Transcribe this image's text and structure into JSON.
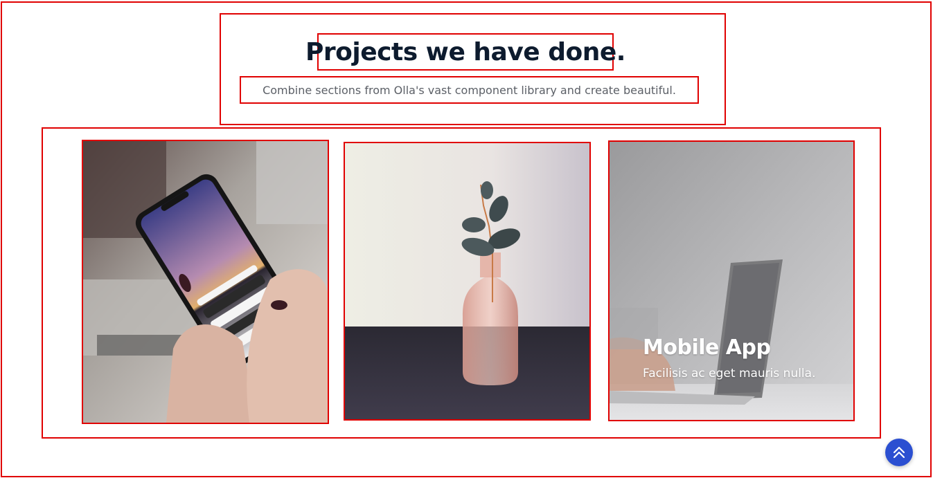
{
  "section": {
    "title": "Projects we have done.",
    "subtitle": "Combine sections from Olla's vast component library and create beautiful."
  },
  "projects": [
    {
      "image": "phone-in-hands-photo"
    },
    {
      "image": "glass-vase-with-eucalyptus-photo"
    },
    {
      "image": "laptop-typing-photo",
      "title": "Mobile App",
      "description": "Facilisis ac eget mauris nulla."
    }
  ],
  "scroll_top": {
    "icon": "double-chevron-up-icon"
  },
  "colors": {
    "title": "#0d1b2e",
    "subtitle": "#5b5f66",
    "outline": "#e00000",
    "scroll_button": "#2b4fd1"
  }
}
